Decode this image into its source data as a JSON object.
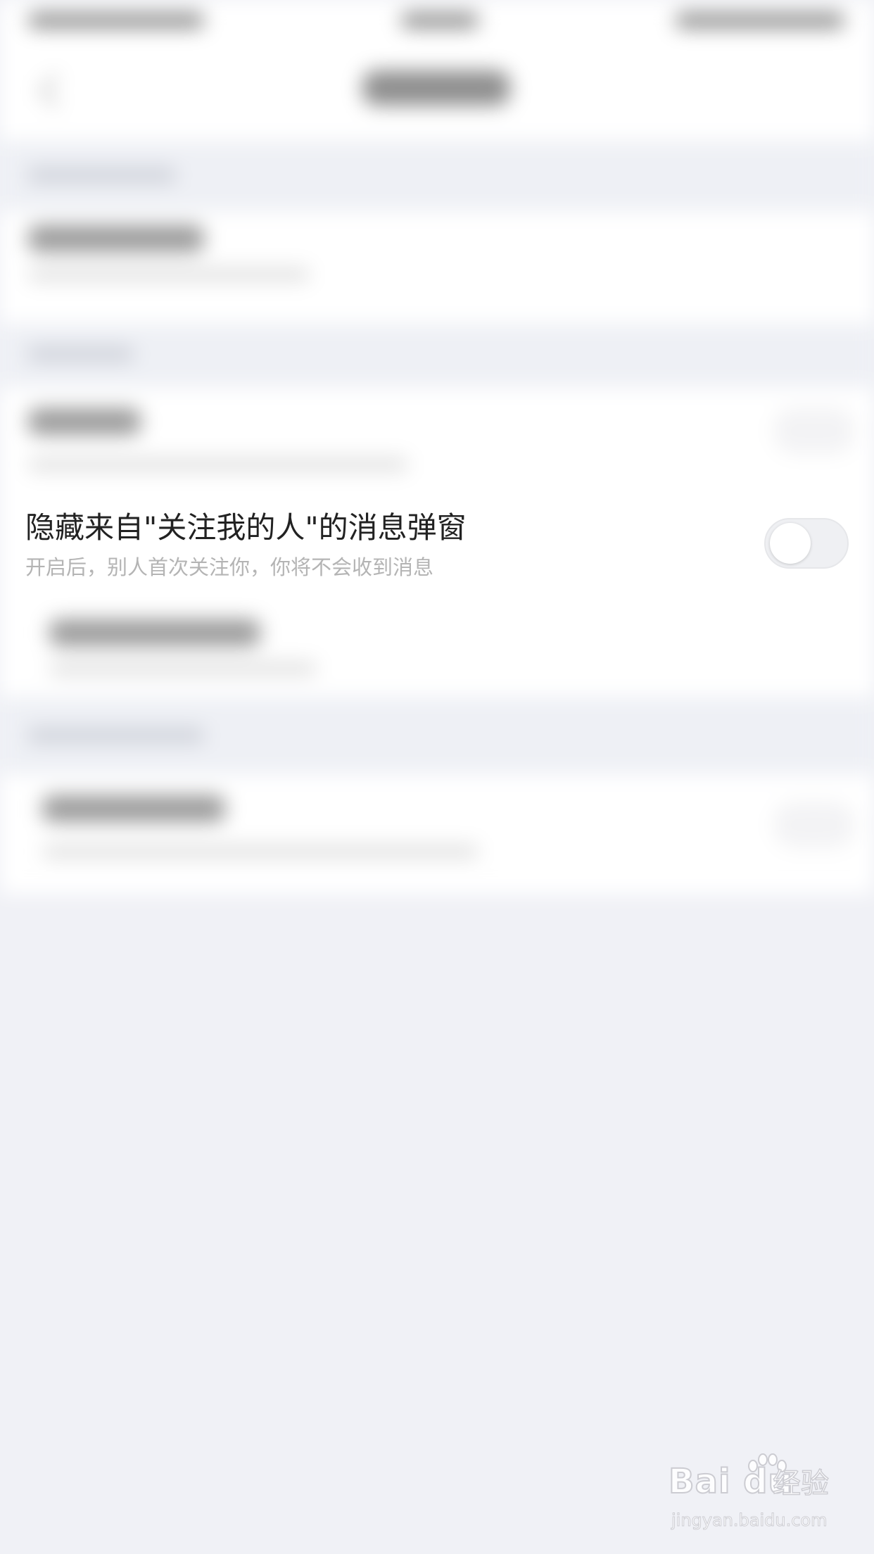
{
  "setting": {
    "title": "隐藏来自\"关注我的人\"的消息弹窗",
    "description": "开启后，别人首次关注你，你将不会收到消息",
    "toggle_state": "off"
  },
  "watermark": {
    "logo_text": "Bai du",
    "cn_text": "经验",
    "url": "jingyan.baidu.com"
  },
  "icons": {
    "back": "chevron-left-icon",
    "toggle": "toggle-switch",
    "watermark": "paw-logo-icon"
  },
  "colors": {
    "background": "#f0f1f6",
    "card": "#ffffff",
    "title_text": "#222222",
    "description_text": "#b4b4b4",
    "toggle_track": "#eff0f3"
  }
}
